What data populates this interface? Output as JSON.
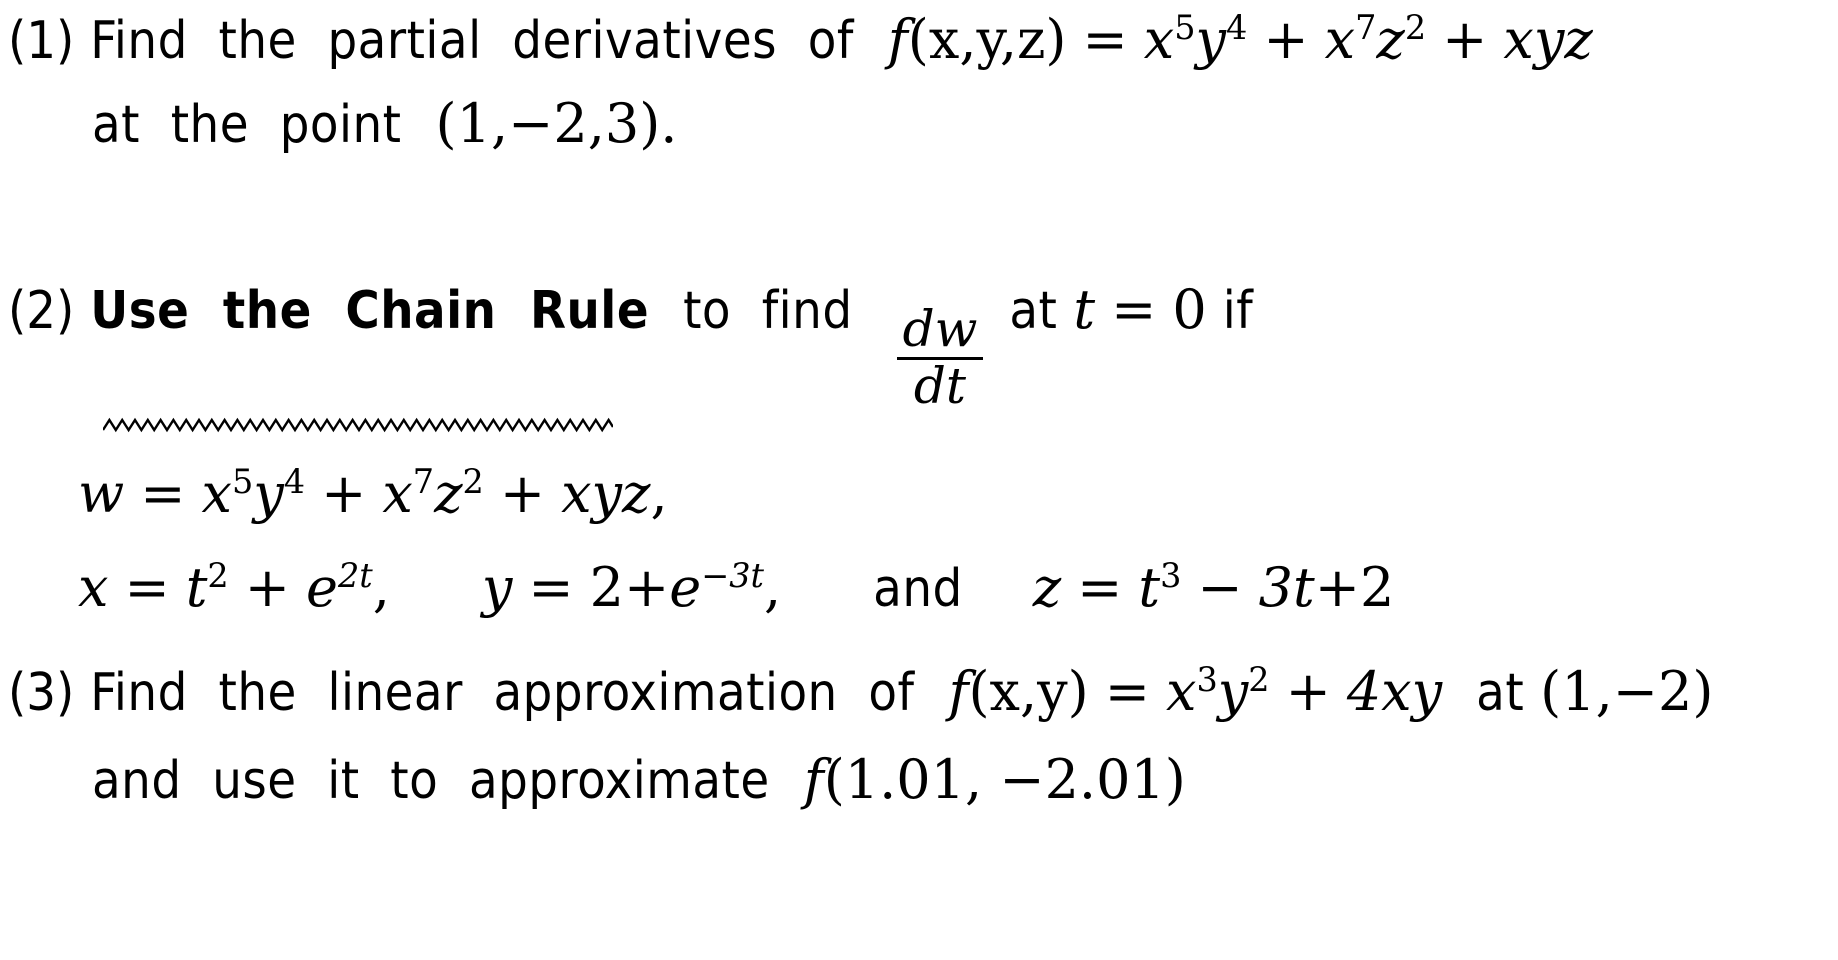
{
  "document": {
    "kind": "math-worksheet",
    "background_color": "#ffffff",
    "text_color": "#000000",
    "problem_count": 3
  },
  "problems": [
    {
      "number": "(1)",
      "lines": [
        {
          "segments": [
            {
              "kind": "text",
              "value": "Find the partial derivatives of"
            },
            {
              "kind": "math",
              "value": "f(x, y, z) = x⁵y⁴ + x⁷z² + xyz"
            }
          ]
        },
        {
          "segments": [
            {
              "kind": "text",
              "value": "at the point"
            },
            {
              "kind": "math",
              "value": "(1, −2, 3)."
            }
          ]
        }
      ],
      "text": {
        "l1_a": "Find  the  partial  derivatives  of",
        "l2_a": "at  the  point"
      },
      "math": {
        "f_name": "f",
        "f_args": "(x,y,z)",
        "equals": "=",
        "term1_base": "x",
        "term1_exp": "5",
        "term1_var2": "y",
        "term1_exp2": "4",
        "plus": "+",
        "term2_base": "x",
        "term2_exp": "7",
        "term2_var2": "z",
        "term2_exp2": "2",
        "term3": "xyz",
        "point": "(1,−2,3)",
        "period": "."
      }
    },
    {
      "number": "(2)",
      "emphasis": "Use the Chain Rule",
      "emphasis_decoration": "squiggly-underline",
      "lines": [
        {
          "segments": [
            {
              "kind": "text-bold",
              "value": "Use the Chain Rule"
            },
            {
              "kind": "text",
              "value": "to find"
            },
            {
              "kind": "math-fraction",
              "numerator": "dw",
              "denominator": "dt"
            },
            {
              "kind": "text",
              "value": "at"
            },
            {
              "kind": "math",
              "value": "t = 0"
            },
            {
              "kind": "text",
              "value": "if"
            }
          ]
        },
        {
          "segments": [
            {
              "kind": "math",
              "value": "w = x⁵y⁴ + x⁷z² + xyz,"
            }
          ]
        },
        {
          "segments": [
            {
              "kind": "math",
              "value": "x = t² + e²ᵗ,"
            },
            {
              "kind": "math",
              "value": "y = 2 + e⁻³ᵗ,"
            },
            {
              "kind": "text",
              "value": "and"
            },
            {
              "kind": "math",
              "value": "z = t³ − 3t + 2"
            }
          ]
        }
      ],
      "text": {
        "bold_phrase": "Use  the  Chain  Rule",
        "to_find": "to  find",
        "at": "at",
        "if": "if",
        "and": "and"
      },
      "math": {
        "frac_numerator": "dw",
        "frac_denominator": "dt",
        "t_var": "t",
        "equals": "=",
        "t_value": "0",
        "w_var": "w",
        "w_term1_base": "x",
        "w_term1_exp": "5",
        "w_term1_var2": "y",
        "w_term1_exp2": "4",
        "plus": "+",
        "w_term2_base": "x",
        "w_term2_exp": "7",
        "w_term2_var2": "z",
        "w_term2_exp2": "2",
        "w_term3": "xyz",
        "comma": ",",
        "x_var": "x",
        "x_t_base": "t",
        "x_t_exp": "2",
        "x_e": "e",
        "x_e_exp": "2t",
        "y_var": "y",
        "y_const": "2",
        "y_e": "e",
        "y_e_exp": "−3t",
        "z_var": "z",
        "z_t_base": "t",
        "z_t_exp": "3",
        "z_minus": "−",
        "z_term2": "3t",
        "z_plus": "+",
        "z_const": "2"
      }
    },
    {
      "number": "(3)",
      "lines": [
        {
          "segments": [
            {
              "kind": "text",
              "value": "Find the linear approximation of"
            },
            {
              "kind": "math",
              "value": "f(x, y) = x³y² + 4xy"
            },
            {
              "kind": "text",
              "value": "at"
            },
            {
              "kind": "math",
              "value": "(1, −2)"
            }
          ]
        },
        {
          "segments": [
            {
              "kind": "text",
              "value": "and use it to approximate"
            },
            {
              "kind": "math",
              "value": "f(1.01, −2.01)"
            }
          ]
        }
      ],
      "text": {
        "l1_a": "Find  the  linear  approximation  of",
        "l1_at": "at",
        "l2_a": "and  use  it  to  approximate"
      },
      "math": {
        "f_name": "f",
        "f_args": "(x,y)",
        "equals": "=",
        "term1_base": "x",
        "term1_exp": "3",
        "term1_var2": "y",
        "term1_exp2": "2",
        "plus": "+",
        "term2": "4xy",
        "point": "(1,−2)",
        "f_name2": "f",
        "f_eval": "(1.01, −2.01)"
      }
    }
  ]
}
